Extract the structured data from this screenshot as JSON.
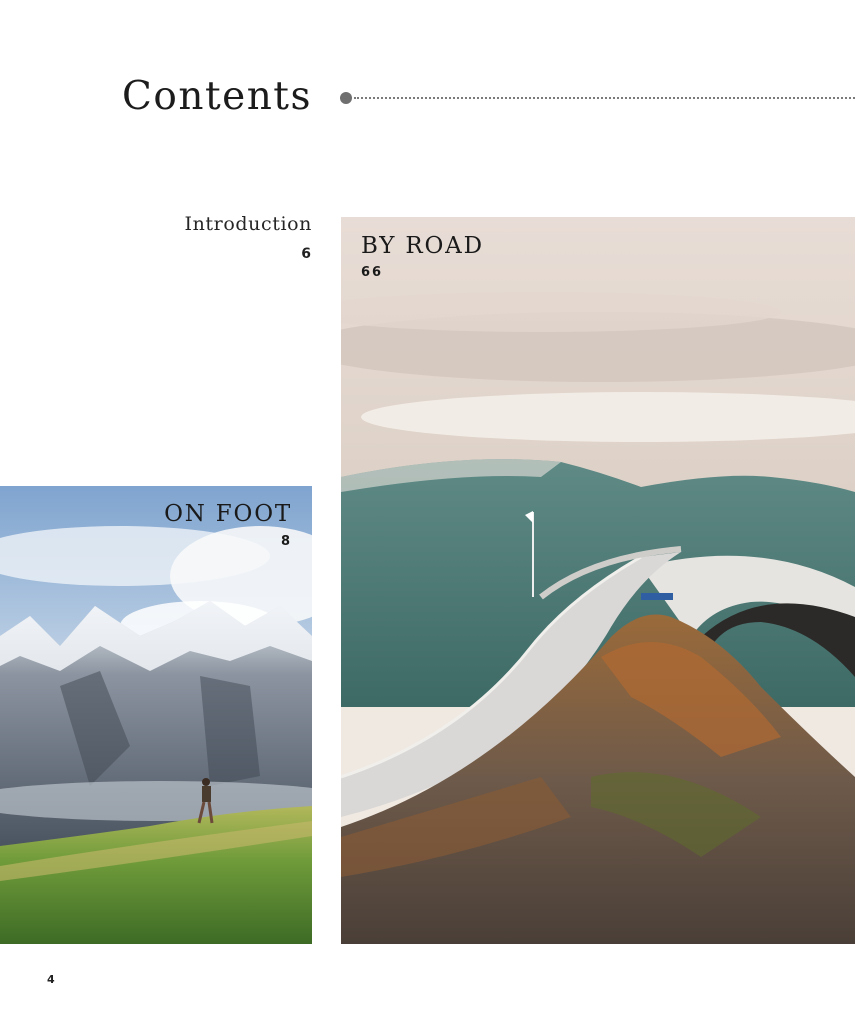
{
  "heading": "Contents",
  "entries": {
    "introduction": {
      "label": "Introduction",
      "page": "6"
    },
    "on_foot": {
      "label": "ON FOOT",
      "page": "8"
    },
    "by_road": {
      "label": "BY ROAD",
      "page": "66"
    }
  },
  "folio": "4",
  "colors": {
    "accent_leader": "#6f6f6f",
    "text": "#1e1e1e",
    "background": "#ffffff"
  }
}
